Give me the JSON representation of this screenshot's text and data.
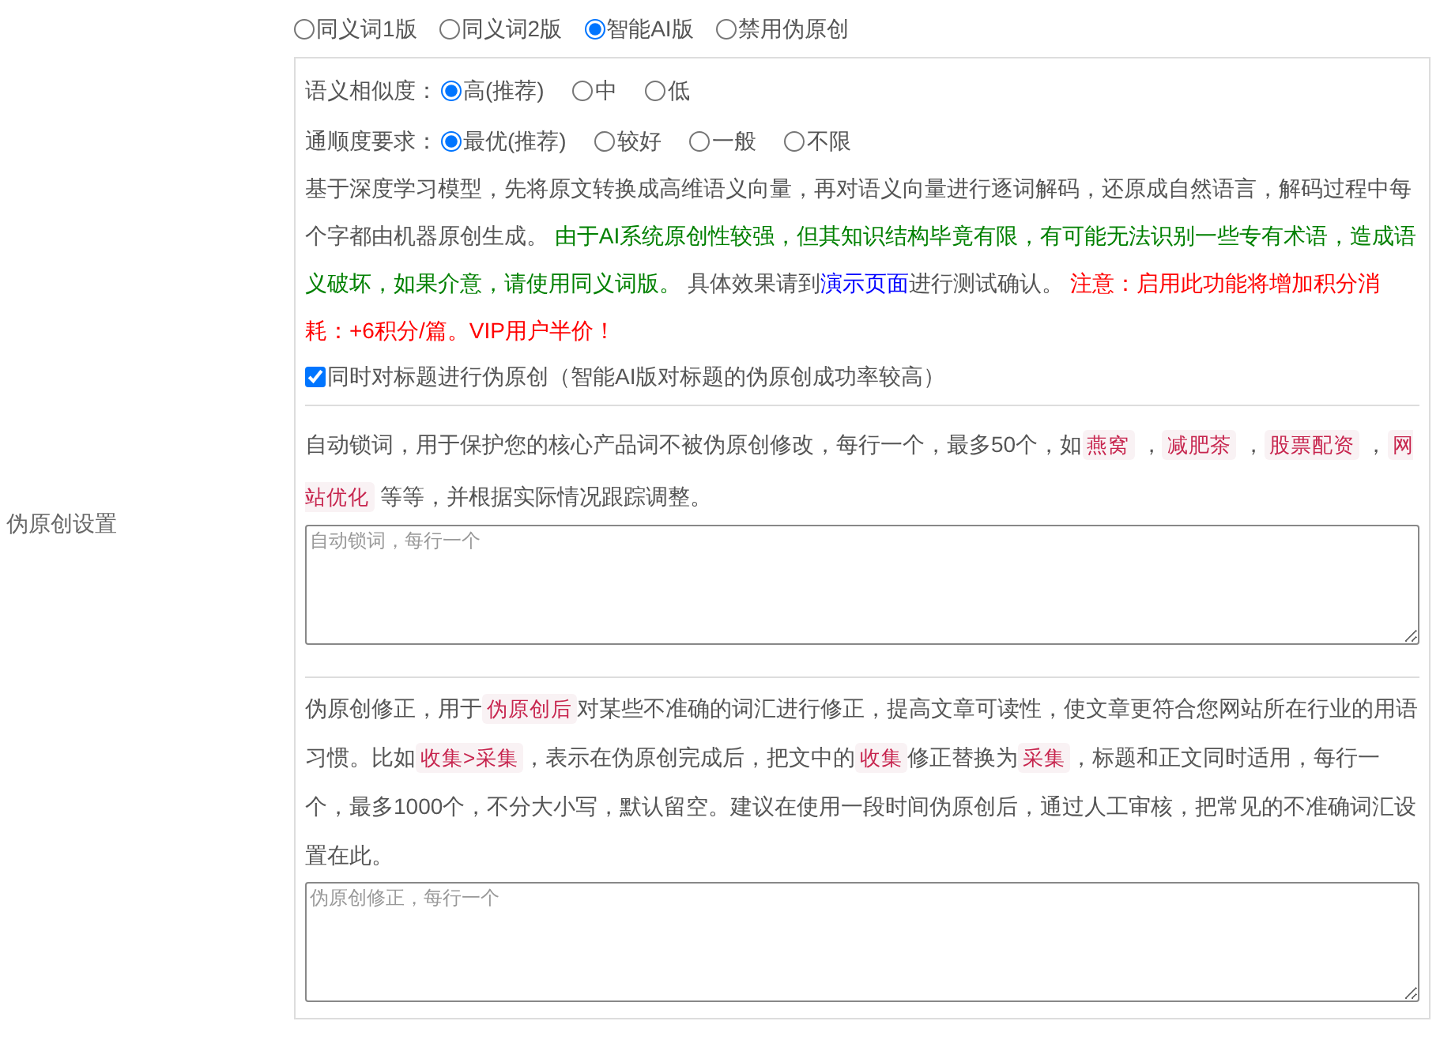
{
  "section_label": "伪原创设置",
  "modes": [
    {
      "label": "同义词1版",
      "selected": false
    },
    {
      "label": "同义词2版",
      "selected": false
    },
    {
      "label": "智能AI版",
      "selected": true
    },
    {
      "label": "禁用伪原创",
      "selected": false
    }
  ],
  "similarity": {
    "label": "语义相似度：",
    "options": [
      {
        "label": "高(推荐)",
        "selected": true
      },
      {
        "label": "中",
        "selected": false
      },
      {
        "label": "低",
        "selected": false
      }
    ]
  },
  "fluency": {
    "label": "通顺度要求：",
    "options": [
      {
        "label": "最优(推荐)",
        "selected": true
      },
      {
        "label": "较好",
        "selected": false
      },
      {
        "label": "一般",
        "selected": false
      },
      {
        "label": "不限",
        "selected": false
      }
    ]
  },
  "ai_description": [
    {
      "kind": "text",
      "text": "基于深度学习模型，先将原文转换成高维语义向量，再对语义向量进行逐词解码，还原成自然语言，解码过程中每个字都由机器原创生成。 "
    },
    {
      "kind": "green",
      "text": "由于AI系统原创性较强，但其知识结构毕竟有限，有可能无法识别一些专有术语，造成语义破坏，如果介意，请使用同义词版。"
    },
    {
      "kind": "text",
      "text": " 具体效果请到"
    },
    {
      "kind": "link",
      "text": "演示页面"
    },
    {
      "kind": "text",
      "text": "进行测试确认。 "
    },
    {
      "kind": "red",
      "text": "注意：启用此功能将增加积分消耗：+6积分/篇。VIP用户半价！"
    }
  ],
  "title_option": {
    "label": "同时对标题进行伪原创（智能AI版对标题的伪原创成功率较高）",
    "checked": true
  },
  "lock_words": {
    "description": [
      {
        "kind": "text",
        "text": "自动锁词，用于保护您的核心产品词不被伪原创修改，每行一个，最多50个，如"
      },
      {
        "kind": "tag",
        "text": "燕窝"
      },
      {
        "kind": "text",
        "text": " ，"
      },
      {
        "kind": "tag",
        "text": "减肥茶"
      },
      {
        "kind": "text",
        "text": " ，"
      },
      {
        "kind": "tag",
        "text": "股票配资"
      },
      {
        "kind": "text",
        "text": " ，"
      },
      {
        "kind": "tag",
        "text": "网站优化"
      },
      {
        "kind": "text",
        "text": " 等等，并根据实际情况跟踪调整。"
      }
    ],
    "placeholder": "自动锁词，每行一个"
  },
  "corrections": {
    "description": [
      {
        "kind": "text",
        "text": "伪原创修正，用于"
      },
      {
        "kind": "tag",
        "text": "伪原创后"
      },
      {
        "kind": "text",
        "text": "对某些不准确的词汇进行修正，提高文章可读性，使文章更符合您网站所在行业的用语习惯。比如"
      },
      {
        "kind": "tag",
        "text": "收集>采集"
      },
      {
        "kind": "text",
        "text": "，表示在伪原创完成后，把文中的"
      },
      {
        "kind": "tag",
        "text": "收集"
      },
      {
        "kind": "text",
        "text": "修正替换为"
      },
      {
        "kind": "tag",
        "text": "采集"
      },
      {
        "kind": "text",
        "text": "，标题和正文同时适用，每行一个，最多1000个，不分大小写，默认留空。建议在使用一段时间伪原创后，通过人工审核，把常见的不准确词汇设置在此。"
      }
    ],
    "placeholder": "伪原创修正，每行一个"
  }
}
